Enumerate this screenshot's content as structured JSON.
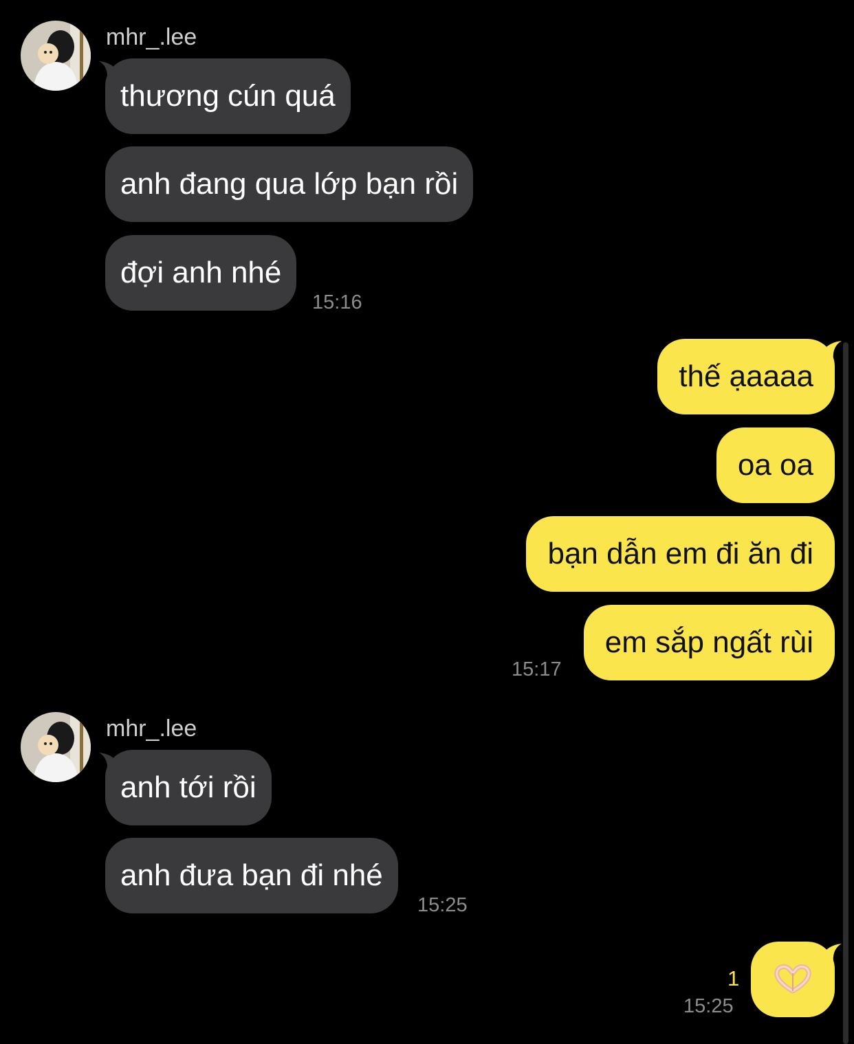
{
  "chat": {
    "groups": [
      {
        "sender": "mhr_.lee",
        "messages": [
          "thương cún quá",
          "anh đang qua lớp bạn rồi",
          "đợi anh nhé"
        ],
        "time": "15:16"
      },
      {
        "messages": [
          "thế ạaaaa",
          "oa oa",
          "bạn dẫn em đi ăn đi",
          "em sắp ngất rùi"
        ],
        "time": "15:17"
      },
      {
        "sender": "mhr_.lee",
        "messages": [
          "anh tới rồi",
          "anh đưa bạn đi nhé"
        ],
        "time": "15:25"
      },
      {
        "sticker": "heart-hands-icon",
        "unread_count": "1",
        "time": "15:25"
      }
    ]
  },
  "colors": {
    "background": "#000000",
    "incoming_bubble": "#3a3a3c",
    "outgoing_bubble": "#fae54d",
    "timestamp": "#8d8d8d"
  }
}
